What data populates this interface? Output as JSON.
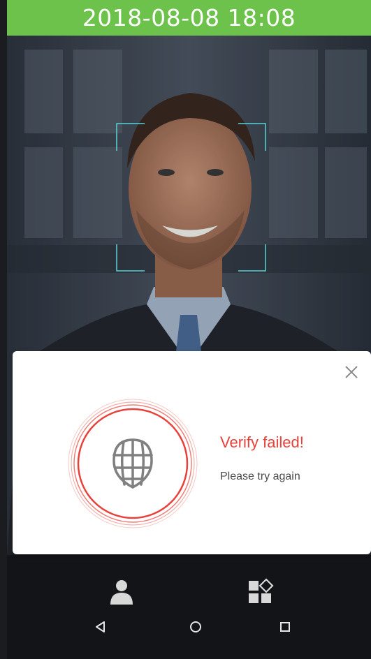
{
  "status_bar": {
    "datetime": "2018-08-08 18:08"
  },
  "dialog": {
    "title": "Verify failed!",
    "subtitle": "Please try again",
    "icon": "face-mesh-icon",
    "accent_color": "#e8403a"
  },
  "colors": {
    "status_green": "#6cc24a",
    "face_frame": "#5ad2d8",
    "bar_dark": "#131417"
  },
  "bottom_bar": {
    "icons": [
      "user-icon",
      "apps-icon"
    ]
  },
  "nav_bar": {
    "icons": [
      "back-icon",
      "home-icon",
      "recents-icon"
    ]
  }
}
